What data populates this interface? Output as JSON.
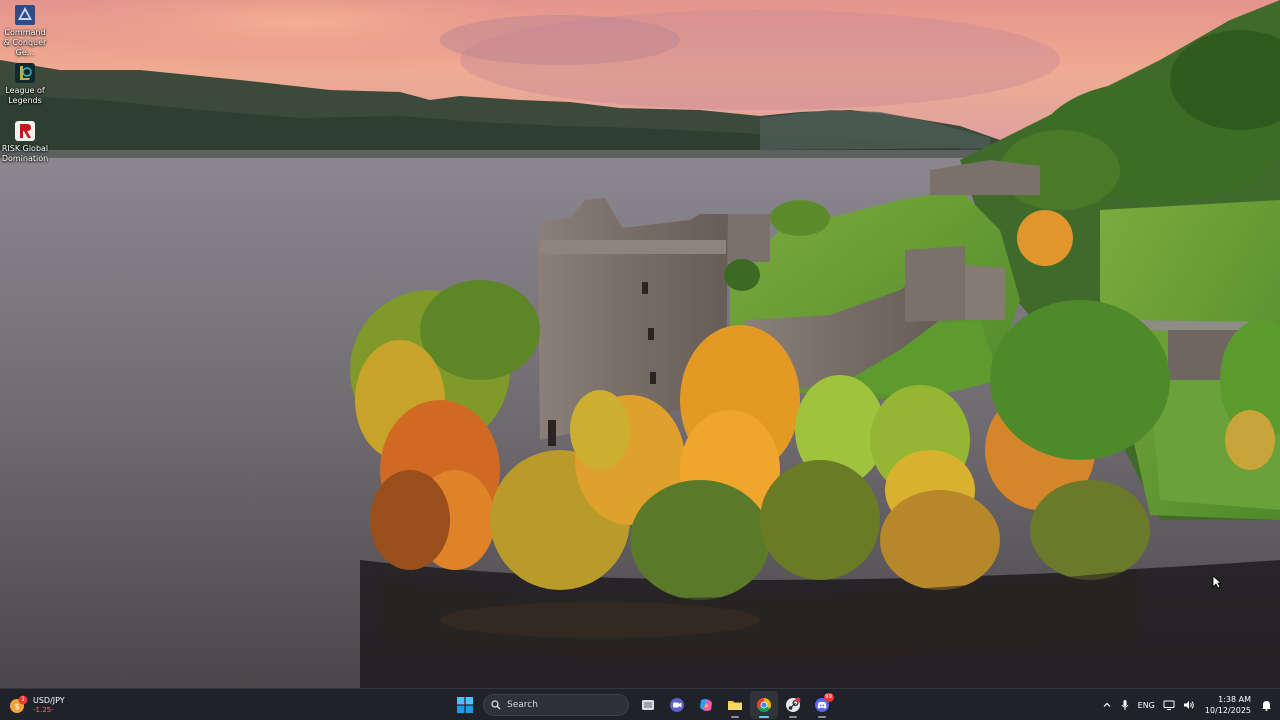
{
  "desktop": {
    "icons": [
      {
        "label": "Command & Conquer Ge...",
        "icon": "command-conquer-icon"
      },
      {
        "label": "League of Legends",
        "icon": "league-of-legends-icon"
      },
      {
        "label": "RISK Global Domination",
        "icon": "risk-icon"
      }
    ]
  },
  "taskbar": {
    "widget": {
      "title": "USD/JPY",
      "change": "-1.25-",
      "badge": "1",
      "icon": "currency-widget-icon"
    },
    "search": {
      "label": "Search"
    },
    "apps": [
      {
        "name": "Start",
        "icon": "windows-start-icon"
      },
      {
        "name": "Task View",
        "icon": "task-view-icon"
      },
      {
        "name": "Meet / Chat",
        "icon": "chat-camera-icon"
      },
      {
        "name": "Copilot",
        "icon": "copilot-icon"
      },
      {
        "name": "File Explorer",
        "icon": "folder-icon"
      },
      {
        "name": "Google Chrome",
        "icon": "chrome-icon"
      },
      {
        "name": "Steam",
        "icon": "steam-icon"
      },
      {
        "name": "Discord",
        "icon": "discord-icon",
        "badge": "99"
      }
    ],
    "tray": {
      "language": "ENG",
      "time": "1:38 AM",
      "date": "10/12/2025"
    }
  },
  "colors": {
    "taskbar_bg": "#1f2228",
    "accent": "#60cdff",
    "sky_top": "#e99a88",
    "water": "#6e6c70"
  }
}
